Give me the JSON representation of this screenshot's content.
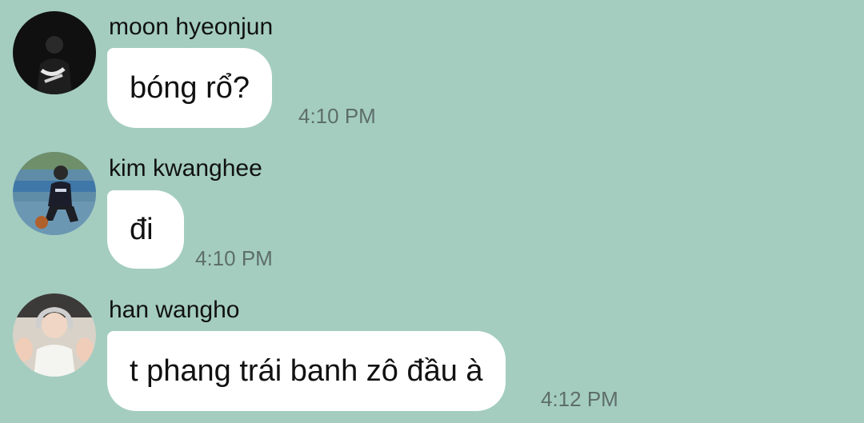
{
  "messages": [
    {
      "sender": "moon hyeonjun",
      "text": "bóng rổ?",
      "time": "4:10 PM"
    },
    {
      "sender": "kim kwanghee",
      "text": "đi",
      "time": "4:10 PM"
    },
    {
      "sender": "han wangho",
      "text": "t phang trái banh zô đầu à",
      "time": "4:12 PM"
    }
  ],
  "colors": {
    "background": "#a4cdc0",
    "bubble": "#ffffff",
    "timestamp": "#5e6e69"
  }
}
